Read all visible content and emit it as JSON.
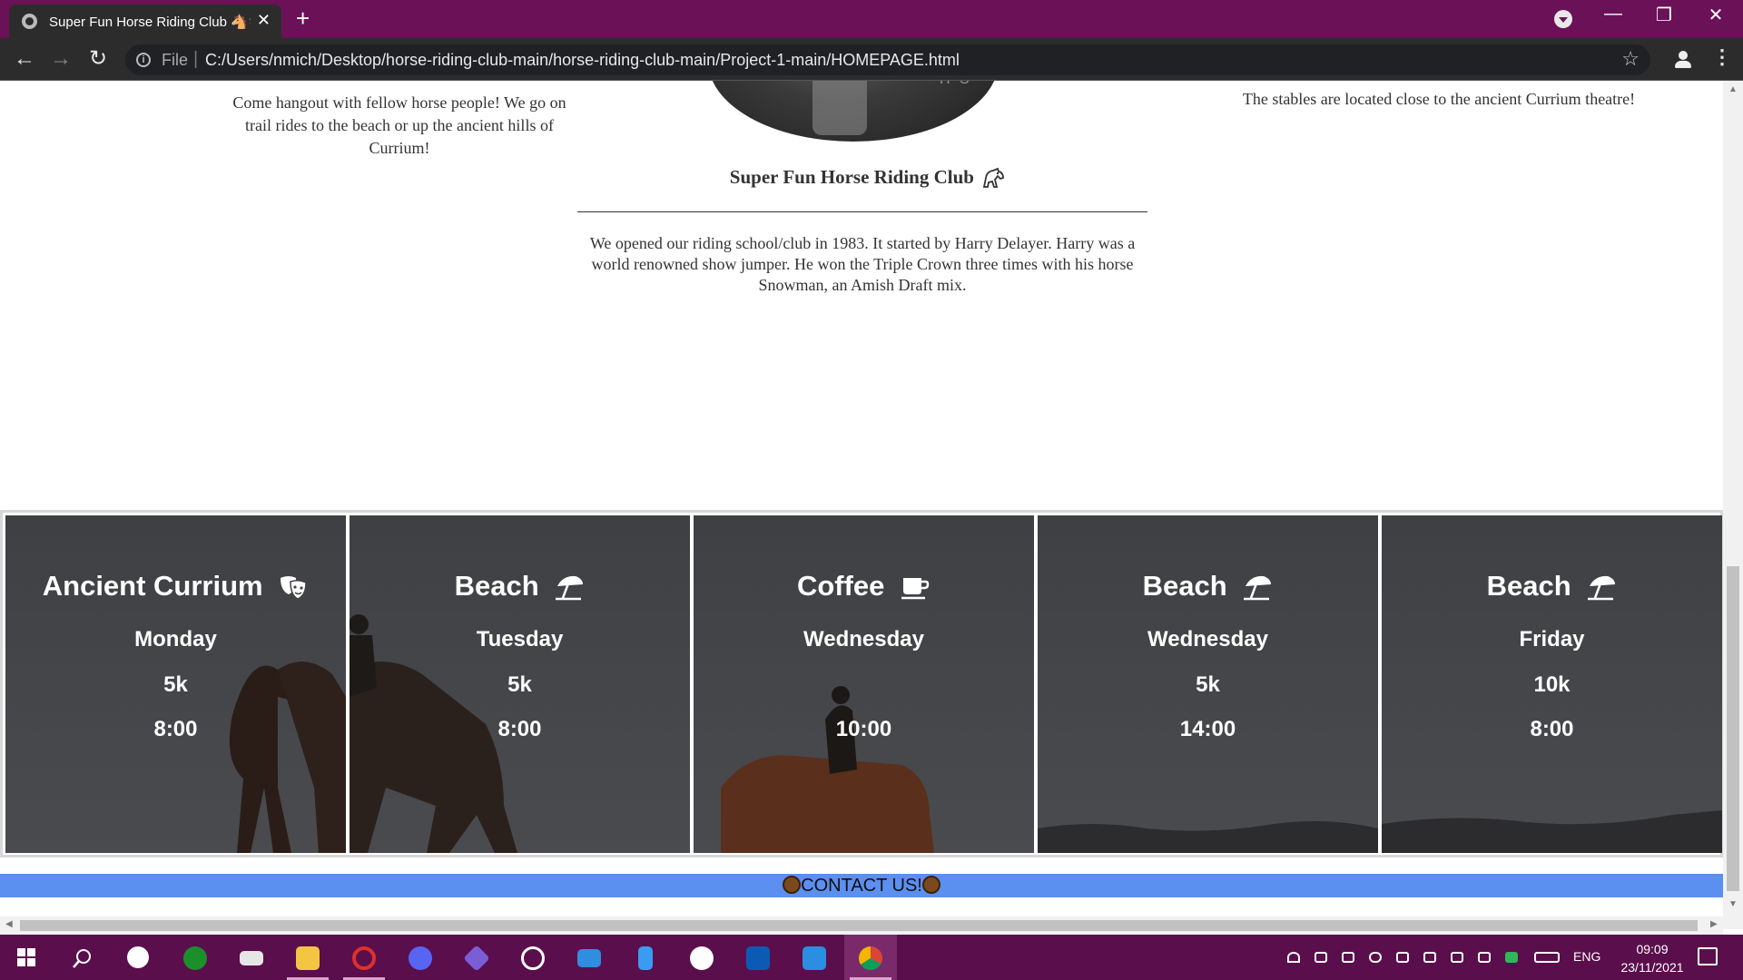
{
  "browser": {
    "tab_title": "Super Fun Horse Riding Club 🐴🌴",
    "new_tab": "+",
    "tab_close": "✕",
    "address_scheme": "File",
    "address_url": "C:/Users/nmich/Desktop/horse-riding-club-main/horse-riding-club-main/Project-1-main/HOMEPAGE.html",
    "window_controls": [
      "—",
      "❐",
      "✕"
    ]
  },
  "page": {
    "intro_left": "Come hangout with fellow horse people! We go on trail rides to the beach or up the ancient hills of Currium!",
    "photo_banner": "H S",
    "club_title": "Super Fun Horse Riding Club",
    "about_text": "We opened our riding school/club in 1983. It started by Harry Delayer. Harry was a world renowned show jumper. He won the Triple Crown three times with his horse Snowman, an Amish Draft mix.",
    "intro_right": "The stables are located close to the ancient Currium theatre!"
  },
  "rides": [
    {
      "location": "Ancient Currium",
      "icon": "theater-masks-icon",
      "day": "Monday",
      "distance": "5k",
      "time": "8:00"
    },
    {
      "location": "Beach",
      "icon": "beach-umbrella-icon",
      "day": "Tuesday",
      "distance": "5k",
      "time": "8:00"
    },
    {
      "location": "Coffee",
      "icon": "coffee-cup-icon",
      "day": "Wednesday",
      "distance": "",
      "time": "10:00"
    },
    {
      "location": "Beach",
      "icon": "beach-umbrella-icon",
      "day": "Wednesday",
      "distance": "5k",
      "time": "14:00"
    },
    {
      "location": "Beach",
      "icon": "beach-umbrella-icon",
      "day": "Friday",
      "distance": "10k",
      "time": "8:00"
    }
  ],
  "contact": {
    "label": "CONTACT US!"
  },
  "taskbar": {
    "apps": [
      "start-icon",
      "search-icon",
      "settings-icon",
      "xbox-icon",
      "stack-icon",
      "file-explorer-icon",
      "opera-icon",
      "discord-icon",
      "vs-icon",
      "speedometer-icon",
      "mail-icon",
      "phone-icon",
      "slack-icon",
      "intel-icon",
      "vscode-icon",
      "chrome-icon"
    ],
    "language": "ENG",
    "time": "09:09",
    "date": "23/11/2021"
  },
  "colors": {
    "tabbar": "#6b1158",
    "taskbar": "#5b0e4c",
    "contact_bar": "#5b8ff0",
    "card_bg": "#434549"
  }
}
